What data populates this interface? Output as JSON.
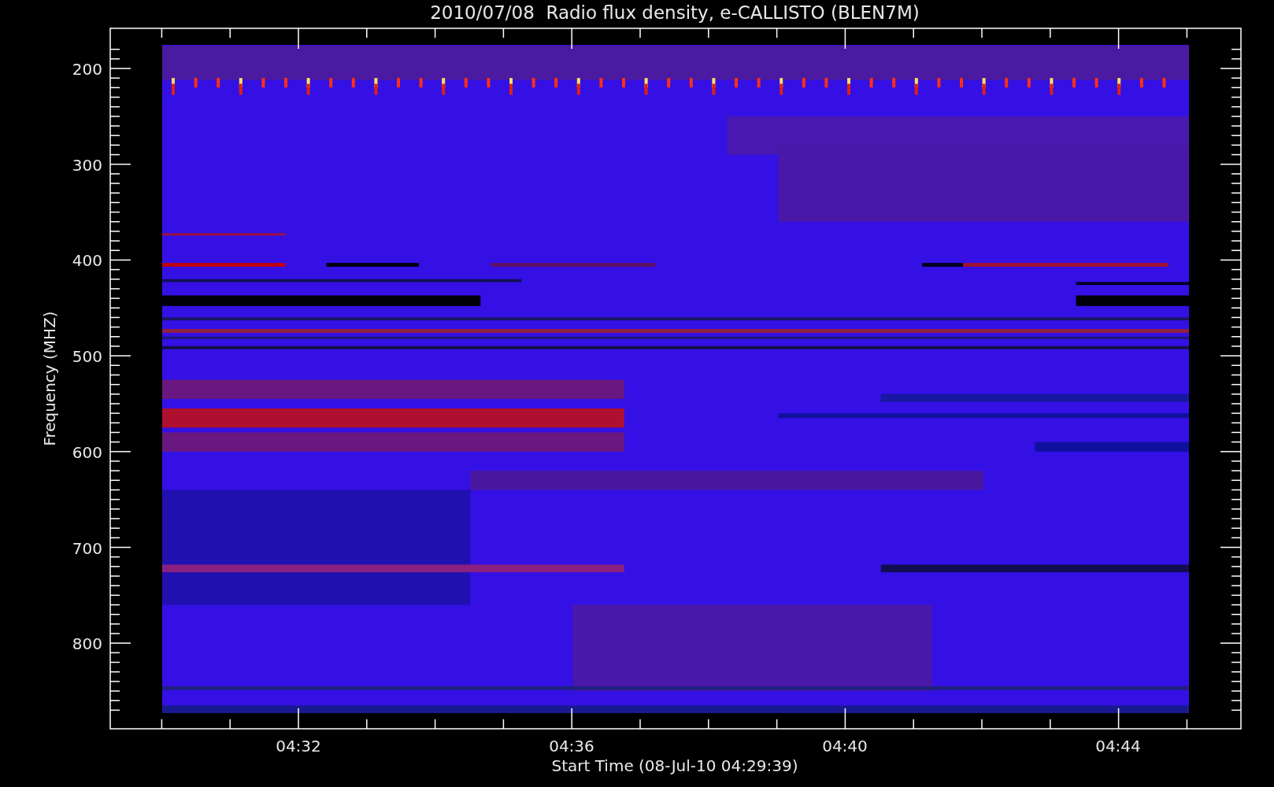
{
  "title": "2010/07/08  Radio flux density, e-CALLISTO (BLEN7M)",
  "y_axis": {
    "label": "Frequency (MHZ)",
    "ticks": [
      "200",
      "300",
      "400",
      "500",
      "600",
      "700",
      "800"
    ]
  },
  "x_axis": {
    "label": "Start Time (08-Jul-10 04:29:39)",
    "ticks": [
      "04:32",
      "04:36",
      "04:40",
      "04:44"
    ]
  }
}
